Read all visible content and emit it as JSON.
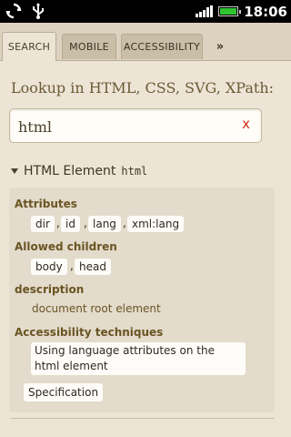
{
  "status_bar": {
    "time": "18:06",
    "icons": [
      "sync-icon",
      "usb-icon",
      "signal-icon",
      "battery-icon"
    ]
  },
  "tabs": [
    {
      "label": "SEARCH",
      "active": true
    },
    {
      "label": "MOBILE",
      "active": false
    },
    {
      "label": "ACCESSIBILITY",
      "active": false
    }
  ],
  "tabs_more_label": "»",
  "lookup": {
    "label": "Lookup in HTML, CSS, SVG, XPath:",
    "query": "html",
    "clear_label": "x"
  },
  "result": {
    "title": "HTML Element",
    "code": "html",
    "sections": {
      "attributes": {
        "title": "Attributes",
        "items": [
          "dir",
          "id",
          "lang",
          "xml:lang"
        ],
        "separator": ","
      },
      "allowed_children": {
        "title": "Allowed children",
        "items": [
          "body",
          "head"
        ],
        "separator": ","
      },
      "description": {
        "title": "description",
        "text": "document root element"
      },
      "accessibility": {
        "title": "Accessibility techniques",
        "items": [
          "Using language attributes on the html element"
        ]
      },
      "specification": {
        "label": "Specification"
      }
    }
  },
  "colors": {
    "background": "#ece5d6",
    "accent": "#6a5423",
    "clear": "#d22b1c"
  }
}
